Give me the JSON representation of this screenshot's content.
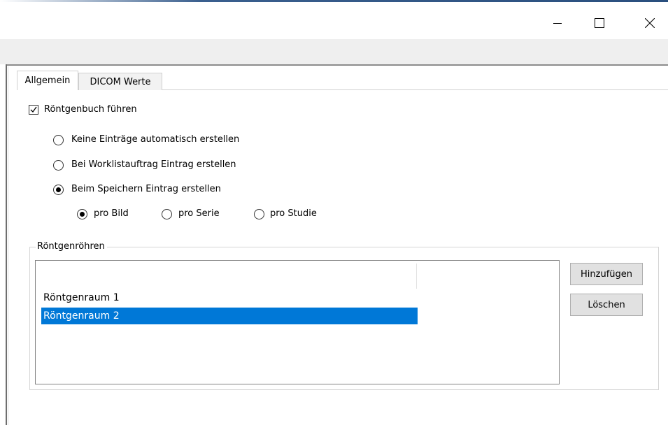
{
  "window": {
    "title": "",
    "controls": {
      "minimize_icon": "minimize-icon",
      "maximize_icon": "maximize-icon",
      "close_icon": "close-icon"
    },
    "accent_color": "#2a4f7e"
  },
  "tabs": [
    {
      "label": "Allgemein",
      "active": true
    },
    {
      "label": "DICOM Werte",
      "active": false
    }
  ],
  "options": {
    "keep_xray_book": {
      "label": "Röntgenbuch führen",
      "checked": true
    },
    "entry_mode": [
      {
        "label": "Keine Einträge automatisch erstellen",
        "checked": false
      },
      {
        "label": "Bei Worklistauftrag Eintrag erstellen",
        "checked": false
      },
      {
        "label": "Beim Speichern Eintrag erstellen",
        "checked": true
      }
    ],
    "granularity": [
      {
        "label": "pro Bild",
        "checked": true
      },
      {
        "label": "pro Serie",
        "checked": false
      },
      {
        "label": "pro Studie",
        "checked": false
      }
    ]
  },
  "tubes_group": {
    "title": "Röntgenröhren",
    "items": [
      {
        "label": "Röntgenraum 1",
        "selected": false
      },
      {
        "label": "Röntgenraum 2",
        "selected": true
      }
    ],
    "selection_color": "#0078d7",
    "add_label": "Hinzufügen",
    "delete_label": "Löschen"
  }
}
